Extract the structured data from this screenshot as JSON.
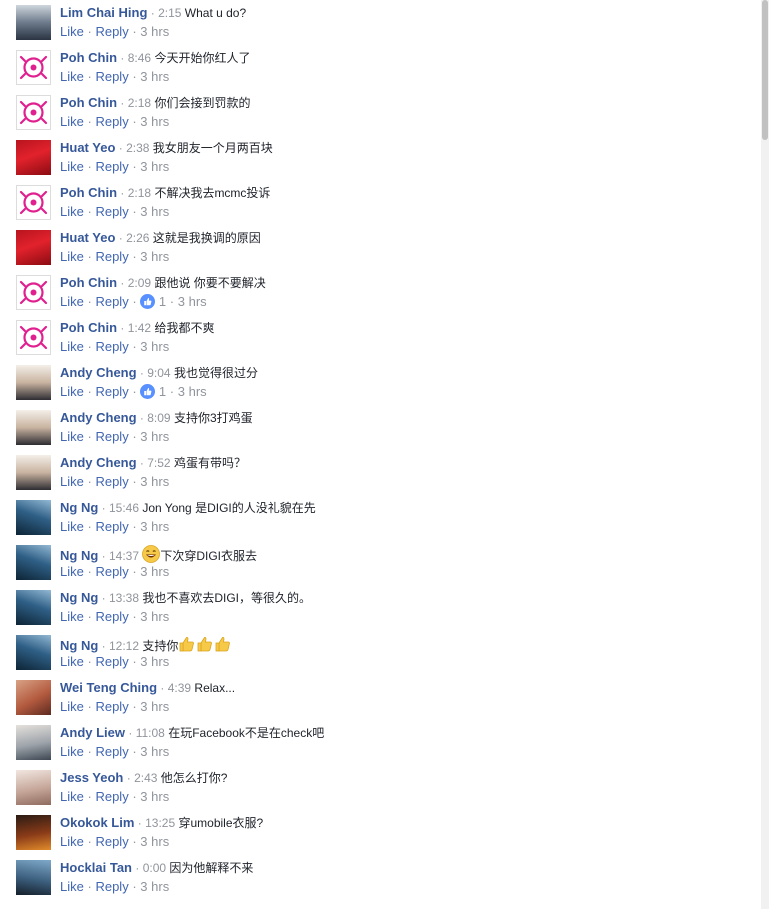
{
  "actions": {
    "like": "Like",
    "reply": "Reply",
    "dot": "·"
  },
  "comments": [
    {
      "author": "Lim Chai Hing",
      "time": "2:15",
      "text": "What u do?",
      "meta": "3 hrs",
      "likes": "",
      "avatar": "lim"
    },
    {
      "author": "Poh Chin",
      "time": "8:46",
      "text": "今天开始你红人了",
      "meta": "3 hrs",
      "likes": "",
      "avatar": "poh"
    },
    {
      "author": "Poh Chin",
      "time": "2:18",
      "text": "你们会接到罚款的",
      "meta": "3 hrs",
      "likes": "",
      "avatar": "poh"
    },
    {
      "author": "Huat Yeo",
      "time": "2:38",
      "text": "我女朋友一个月两百块",
      "meta": "3 hrs",
      "likes": "",
      "avatar": "huat"
    },
    {
      "author": "Poh Chin",
      "time": "2:18",
      "text": "不解决我去mcmc投诉",
      "meta": "3 hrs",
      "likes": "",
      "avatar": "poh"
    },
    {
      "author": "Huat Yeo",
      "time": "2:26",
      "text": "这就是我换调的原因",
      "meta": "3 hrs",
      "likes": "",
      "avatar": "huat"
    },
    {
      "author": "Poh Chin",
      "time": "2:09",
      "text": "跟他说 你要不要解决",
      "meta": "3 hrs",
      "likes": "1",
      "avatar": "poh"
    },
    {
      "author": "Poh Chin",
      "time": "1:42",
      "text": "给我都不爽",
      "meta": "3 hrs",
      "likes": "",
      "avatar": "poh"
    },
    {
      "author": "Andy Cheng",
      "time": "9:04",
      "text": "我也觉得很过分",
      "meta": "3 hrs",
      "likes": "1",
      "avatar": "andy"
    },
    {
      "author": "Andy Cheng",
      "time": "8:09",
      "text": "支持你3打鸡蛋",
      "meta": "3 hrs",
      "likes": "",
      "avatar": "andy"
    },
    {
      "author": "Andy Cheng",
      "time": "7:52",
      "text": "鸡蛋有带吗？",
      "meta": "3 hrs",
      "likes": "",
      "avatar": "andy"
    },
    {
      "author": "Ng Ng",
      "time": "15:46",
      "text": "Jon Yong 是DIGI的人没礼貌在先",
      "meta": "3 hrs",
      "likes": "",
      "avatar": "ng"
    },
    {
      "author": "Ng Ng",
      "time": "14:37",
      "text": "下次穿DIGI衣服去",
      "meta": "3 hrs",
      "likes": "",
      "avatar": "ng",
      "emoji": "laugh"
    },
    {
      "author": "Ng Ng",
      "time": "13:38",
      "text": "我也不喜欢去DIGI，等很久的。",
      "meta": "3 hrs",
      "likes": "",
      "avatar": "ng"
    },
    {
      "author": "Ng Ng",
      "time": "12:12",
      "text": "支持你",
      "meta": "3 hrs",
      "likes": "",
      "avatar": "ng",
      "emoji_after": "thumbs3"
    },
    {
      "author": "Wei Teng Ching",
      "time": "4:39",
      "text": "Relax...",
      "meta": "3 hrs",
      "likes": "",
      "avatar": "wei"
    },
    {
      "author": "Andy Liew",
      "time": "11:08",
      "text": "在玩Facebook不是在check吧",
      "meta": "3 hrs",
      "likes": "",
      "avatar": "liew"
    },
    {
      "author": "Jess Yeoh",
      "time": "2:43",
      "text": "他怎么打你?",
      "meta": "3 hrs",
      "likes": "",
      "avatar": "jess"
    },
    {
      "author": "Okokok Lim",
      "time": "13:25",
      "text": "穿umobile衣服?",
      "meta": "3 hrs",
      "likes": "",
      "avatar": "okokok"
    },
    {
      "author": "Hocklai Tan",
      "time": "0:00",
      "text": "因为他解释不来",
      "meta": "3 hrs",
      "likes": "",
      "avatar": "hocklai"
    }
  ]
}
